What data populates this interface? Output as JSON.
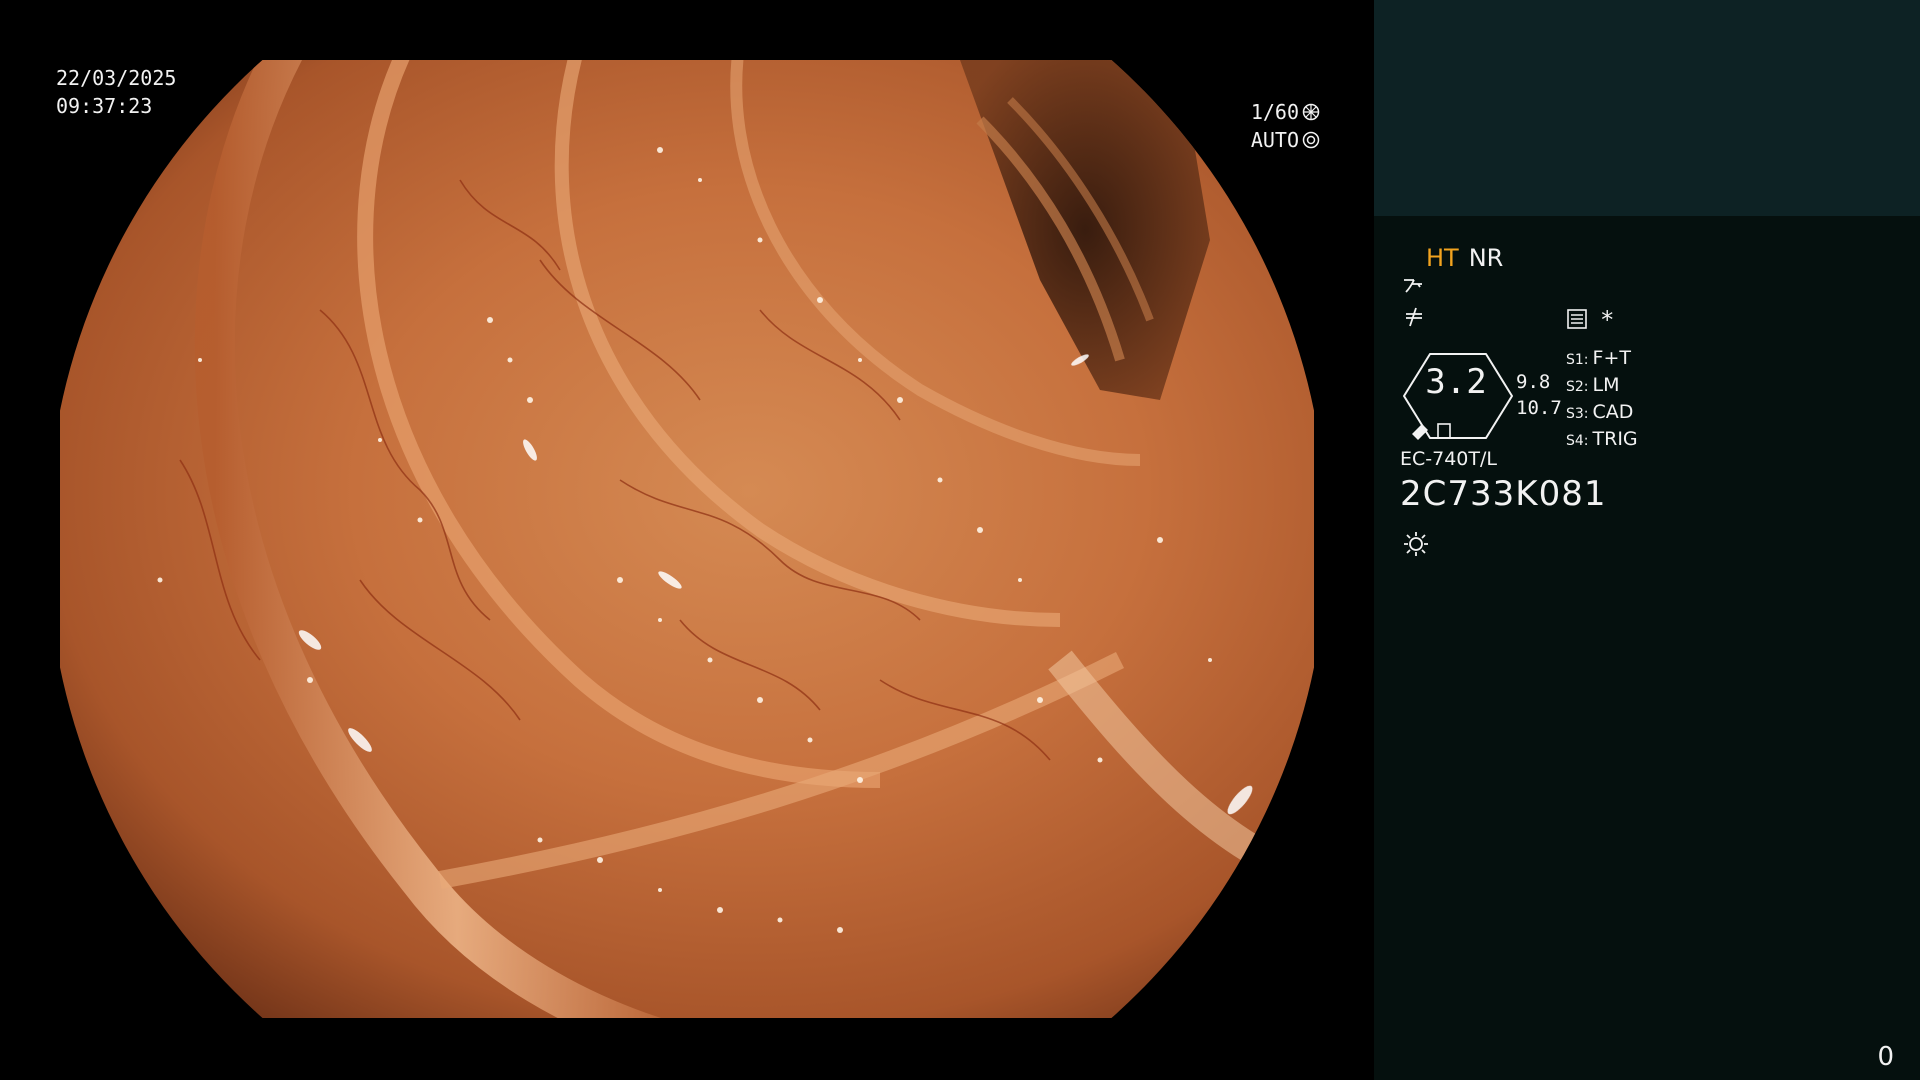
{
  "overlay": {
    "date": "22/03/2025",
    "time": "09:37:23",
    "shutter": "1/60",
    "iris": "AUTO"
  },
  "panel": {
    "mode_ht": "HT",
    "mode_nr": "NR",
    "gauge_value": "3.2",
    "side_top": "9.8",
    "side_bottom": "10.7",
    "switches": [
      {
        "key": "S1:",
        "value": "F+T"
      },
      {
        "key": "S2:",
        "value": "LM"
      },
      {
        "key": "S3:",
        "value": "CAD"
      },
      {
        "key": "S4:",
        "value": "TRIG"
      }
    ],
    "asterisk": "*",
    "scope_model": "EC-740T/L",
    "scope_serial": "2C733K081",
    "counter": "0"
  },
  "colors": {
    "ht_accent": "#f2a31f",
    "panel_bg": "#05100e",
    "panel_top_bg": "#0d2224",
    "mucosa": "#c8703c"
  },
  "icons": [
    "shutter-icon",
    "iris-icon",
    "enhance-icon",
    "color-icon",
    "menu-icon",
    "gauge-icon",
    "light-icon"
  ]
}
